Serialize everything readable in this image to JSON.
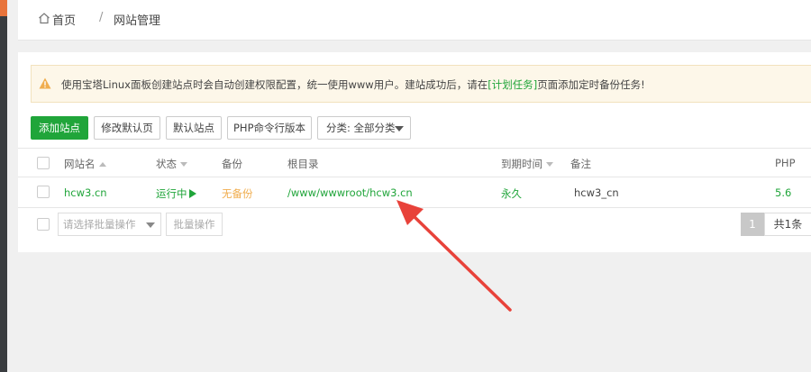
{
  "breadcrumb": {
    "home": "首页",
    "separator": "/",
    "current": "网站管理"
  },
  "alert": {
    "text_before": "使用宝塔Linux面板创建站点时会自动创建权限配置，统一使用www用户。建站成功后，请在",
    "link": "[计划任务]",
    "text_after": "页面添加定时备份任务!"
  },
  "toolbar": {
    "add_site": "添加站点",
    "edit_default_page": "修改默认页",
    "default_site": "默认站点",
    "php_cli_version": "PHP命令行版本",
    "category_select": "分类: 全部分类"
  },
  "table": {
    "headers": {
      "site_name": "网站名",
      "status": "状态",
      "backup": "备份",
      "root_dir": "根目录",
      "expiry": "到期时间",
      "note": "备注",
      "php": "PHP"
    },
    "rows": [
      {
        "site_name": "hcw3.cn",
        "status": "运行中",
        "backup": "无备份",
        "root_dir": "/www/wwwroot/hcw3.cn",
        "expiry": "永久",
        "note": "hcw3_cn",
        "php": "5.6"
      }
    ]
  },
  "footer": {
    "batch_select_placeholder": "请选择批量操作",
    "batch_button": "批量操作",
    "current_page": "1",
    "total": "共1条"
  },
  "colors": {
    "primary_green": "#20a53a",
    "warning_orange": "#f0ad4e",
    "annotation_red": "#e8423a"
  }
}
